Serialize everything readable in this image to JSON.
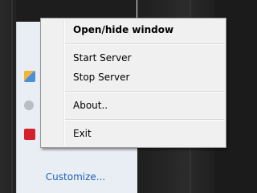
{
  "context_menu": {
    "items": [
      {
        "label": "Open/hide window",
        "bold": true
      },
      {
        "label": "Start Server"
      },
      {
        "label": "Stop Server"
      },
      {
        "label": "About.."
      },
      {
        "label": "Exit"
      }
    ]
  },
  "tray": {
    "customize_link": "Customize...",
    "icons": [
      "app-tray-icon",
      "speaker-tray-icon",
      "red-tray-icon"
    ]
  },
  "colors": {
    "menu_bg": "#f0f0f0",
    "menu_border": "#979797",
    "link": "#1e5fb4",
    "tray_bg": "#e9eef4",
    "desktop_bg": "#1b1b1b"
  }
}
